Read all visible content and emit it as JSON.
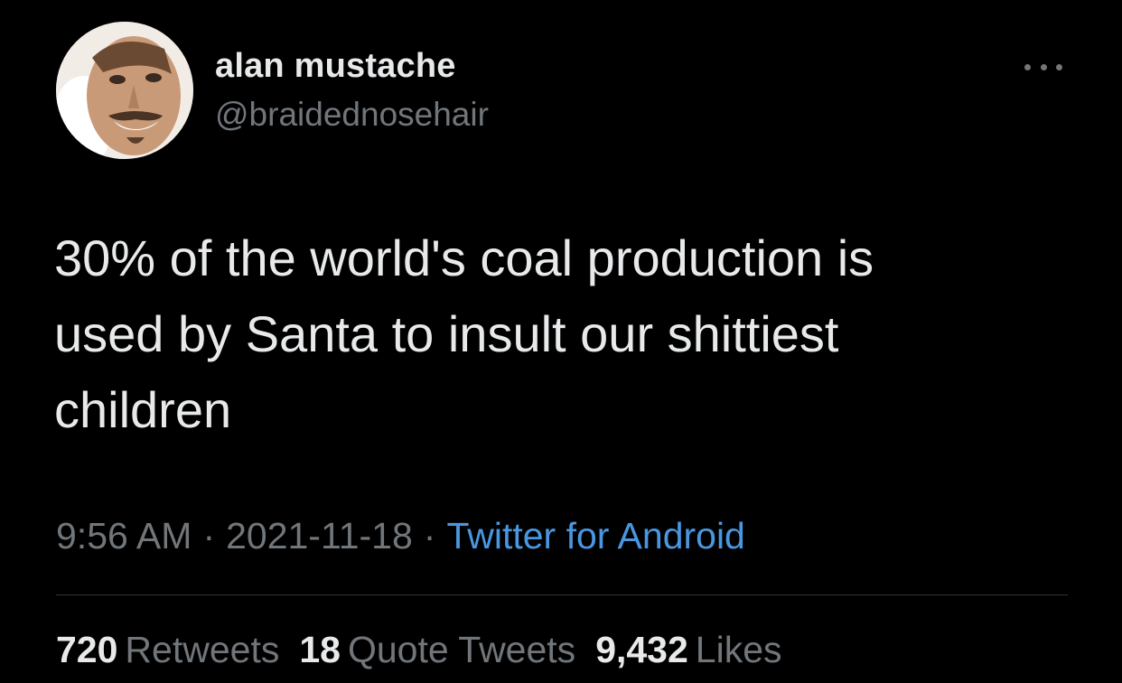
{
  "author": {
    "display_name": "alan mustache",
    "handle": "@braidednosehair",
    "avatar_icon": "profile-photo-man-smiling"
  },
  "more_icon": "ellipsis-horizontal-icon",
  "tweet": {
    "text": "30% of the world's coal production is\nused by Santa to insult our shittiest\nchildren"
  },
  "meta": {
    "time": "9:56 AM",
    "separator": "·",
    "date": "2021-11-18",
    "source": "Twitter for Android"
  },
  "stats": {
    "retweets": {
      "count": "720",
      "label": "Retweets"
    },
    "quote_tweets": {
      "count": "18",
      "label": "Quote Tweets"
    },
    "likes": {
      "count": "9,432",
      "label": "Likes"
    }
  },
  "colors": {
    "background": "#000000",
    "primary_text": "#e7e9ea",
    "secondary_text": "#71767b",
    "link": "#4a97e1",
    "divider": "#2f3336"
  }
}
